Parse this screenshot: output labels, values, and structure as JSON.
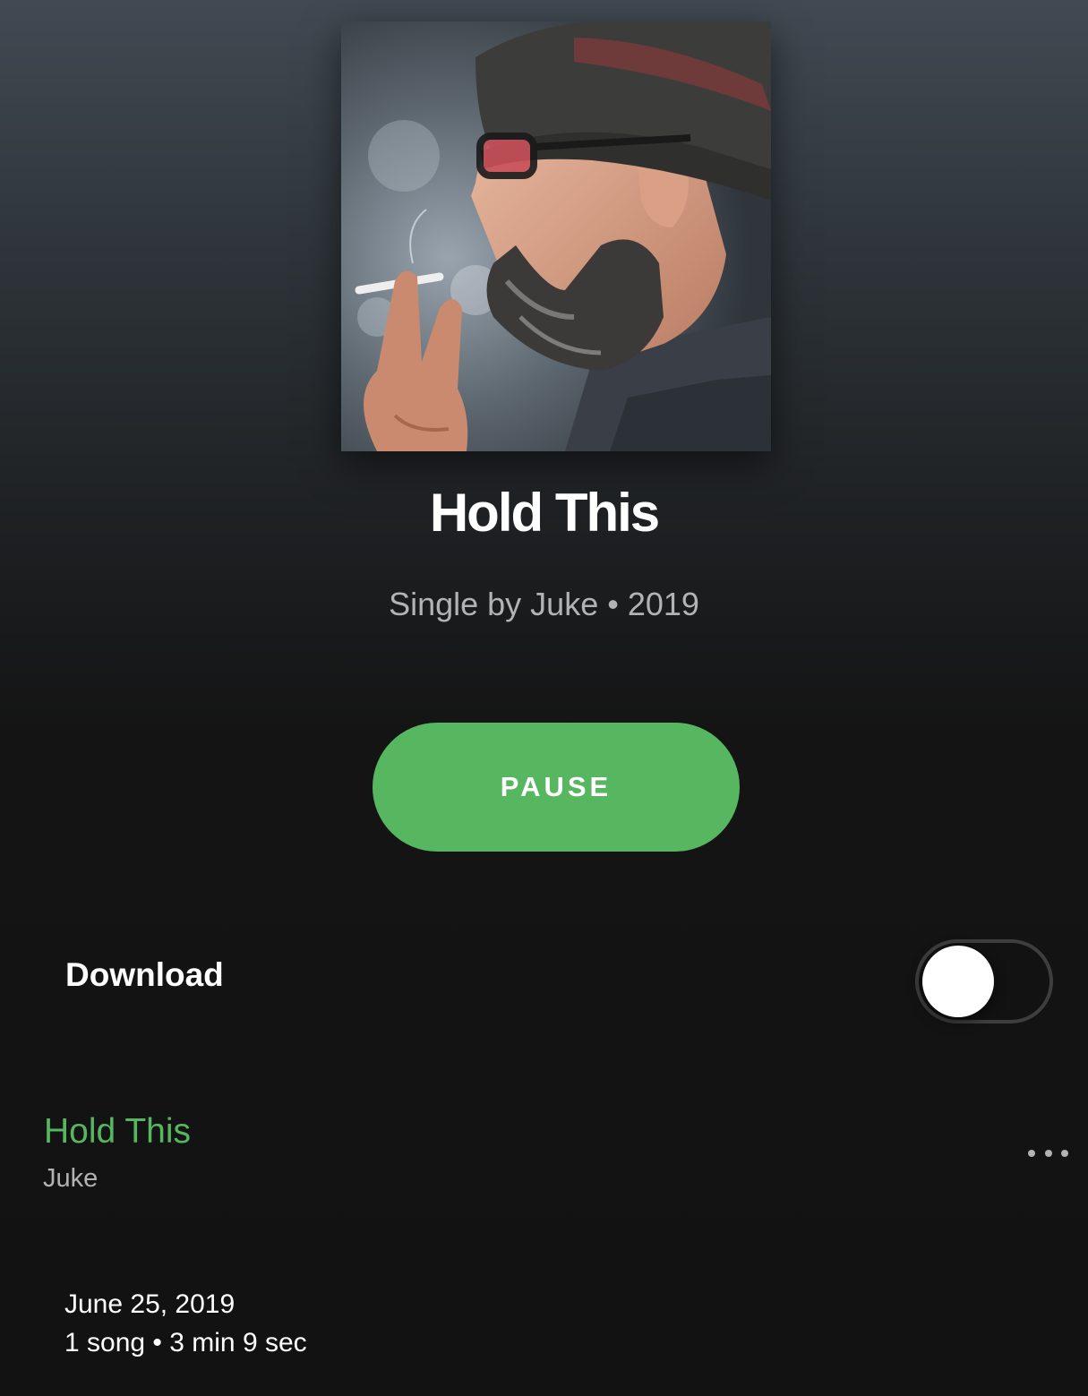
{
  "album": {
    "cover_icon": "album-cover-portrait",
    "title": "Hold This",
    "subtitle": "Single by Juke • 2019"
  },
  "controls": {
    "pause_label": "PAUSE",
    "accent_color": "#57b660"
  },
  "download": {
    "label": "Download",
    "enabled": false
  },
  "tracks": [
    {
      "title": "Hold This",
      "artist": "Juke",
      "playing": true,
      "more_icon": "more-horizontal-icon"
    }
  ],
  "footer": {
    "release_date": "June 25, 2019",
    "summary": "1 song • 3 min 9 sec"
  }
}
